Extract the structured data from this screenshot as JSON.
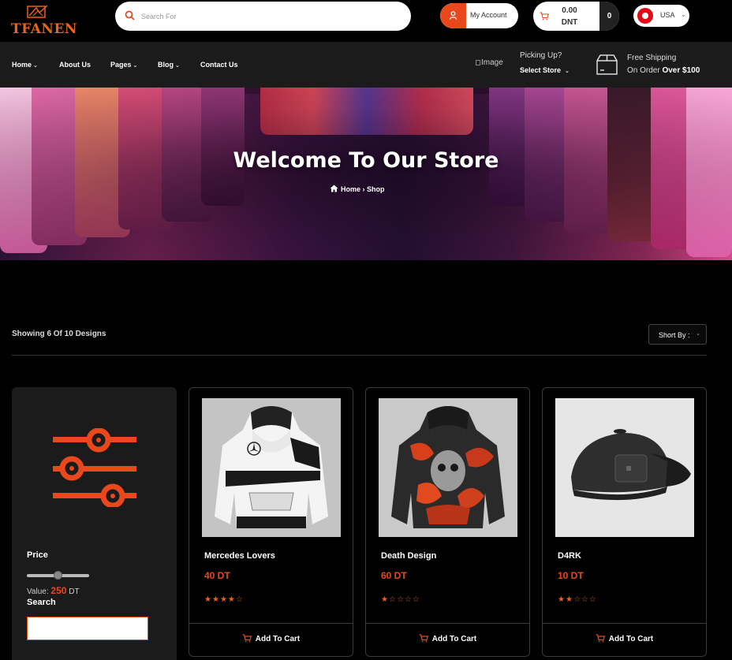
{
  "header": {
    "logo_text": "TFANEN",
    "search_placeholder": "Search For",
    "account_label": "My Account",
    "cart_amount_line1": "0.00",
    "cart_amount_line2": "DNT",
    "cart_count": "0",
    "language": "USA"
  },
  "nav": {
    "items": [
      {
        "label": "Home",
        "has_dropdown": true
      },
      {
        "label": "About Us",
        "has_dropdown": false
      },
      {
        "label": "Pages",
        "has_dropdown": true
      },
      {
        "label": "Blog",
        "has_dropdown": true
      },
      {
        "label": "Contact Us",
        "has_dropdown": false
      }
    ],
    "pickup_image_alt": "Image",
    "pickup_title": "Picking Up?",
    "pickup_store": "Select Store",
    "shipping_line1": "Free Shipping",
    "shipping_line2_prefix": "On Order",
    "shipping_line2_bold": "Over $100"
  },
  "hero": {
    "title": "Welcome To Our Store",
    "breadcrumb_home": "Home",
    "breadcrumb_sep": "›",
    "breadcrumb_current": "Shop"
  },
  "toolbar": {
    "showing": "Showing 6 Of 10 Designs",
    "sort_label": "Short By :"
  },
  "sidebar": {
    "price_label": "Price",
    "value_prefix": "Value:",
    "value": "250",
    "value_unit": "DT",
    "slider_fraction": 0.5,
    "search_label": "Search"
  },
  "products": [
    {
      "name": "Mercedes Lovers",
      "price": "40 DT",
      "rating": 4,
      "cta": "Add To Cart"
    },
    {
      "name": "Death Design",
      "price": "60 DT",
      "rating": 1,
      "cta": "Add To Cart"
    },
    {
      "name": "D4RK",
      "price": "10 DT",
      "rating": 2,
      "cta": "Add To Cart"
    }
  ],
  "colors": {
    "accent": "#e8481b",
    "logo": "#e8641b",
    "background": "#000000",
    "panel": "#1b1b1b"
  },
  "icons": {
    "search": "search-icon",
    "account": "user-icon",
    "cart": "cart-icon",
    "shipping": "box-icon",
    "filter": "sliders-icon",
    "home": "home-icon"
  }
}
